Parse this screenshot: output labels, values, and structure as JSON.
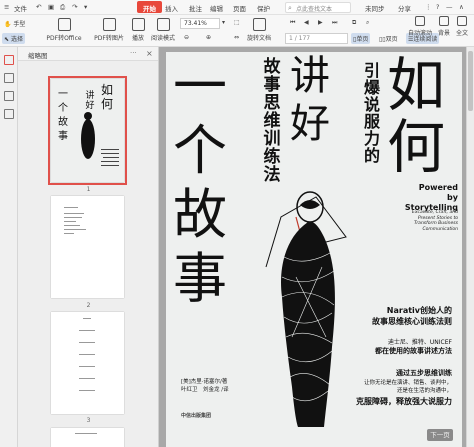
{
  "menu": {
    "file": "文件",
    "start": "开始",
    "insert": "插入",
    "annotate": "批注",
    "edit": "编辑",
    "page": "页面",
    "protect": "保护",
    "search_placeholder": "点此查找文本",
    "sync": "未同步",
    "share": "分享"
  },
  "toolbar": {
    "hand": "手型",
    "select": "选择",
    "pdf_to_office": "PDF转Office",
    "pdf_to_image": "PDF转图片",
    "play": "播放",
    "read_mode": "阅读模式",
    "zoom": "73.41%",
    "rotate_doc": "旋转文档",
    "single_page": "单页",
    "two_page": "双页",
    "continuous": "连续阅读",
    "auto_scroll": "自动滚动",
    "background": "背景",
    "full_text": "全文",
    "page_indicator": "1 / 177"
  },
  "thumbnails": {
    "title": "缩略图",
    "pages": [
      "1",
      "2",
      "3"
    ],
    "mini_title": "如何讲好一个故事",
    "mini_subtitle": "引爆说服力的故事思维训练法"
  },
  "cover": {
    "title_chars": [
      "如",
      "何",
      "讲",
      "好",
      "一",
      "个",
      "故",
      "事"
    ],
    "subtitle": "引爆说服力的故事思维训练法",
    "powered_lines": [
      "Powered",
      "by",
      "Storytelling"
    ],
    "english_lines": [
      "Excavate, Craft, and",
      "Present Stories to",
      "Transform Business",
      "Communication"
    ],
    "narativ": "Narativ创始人的",
    "narativ2": "故事思维核心训练法则",
    "clients": "迪士尼、推特、UNICEF",
    "clients2": "都在使用的故事讲述方法",
    "steps": "通过五步思维训练",
    "steps2": "让你无论是在演讲、销售、谈判中，",
    "steps3": "还是在生活的沟通中，",
    "steps4": "克服障碍，释放强大说服力",
    "author": "[美]杰里·诺塞尔/著",
    "translators": "叶红卫　刘金龙 /译",
    "publisher": "中信出版集团"
  },
  "next_button": "下一页"
}
